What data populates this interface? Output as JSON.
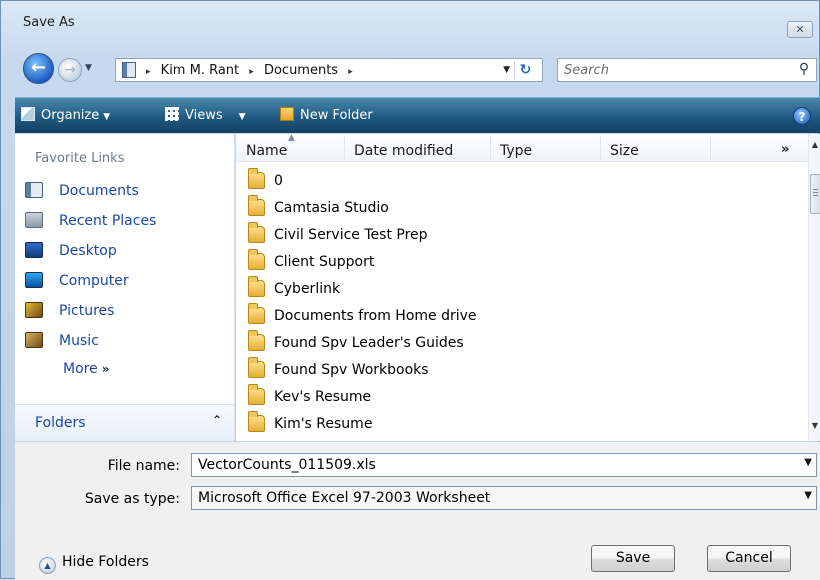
{
  "window": {
    "title": "Save As",
    "close_glyph": "✕"
  },
  "address": {
    "crumbs": [
      "Kim M. Rant",
      "Documents"
    ],
    "separator": "▸"
  },
  "search": {
    "placeholder": "Search"
  },
  "toolbar": {
    "organize_label": "Organize",
    "views_label": "Views",
    "new_folder_label": "New Folder",
    "help_glyph": "?"
  },
  "nav": {
    "favorites_heading": "Favorite Links",
    "links": [
      {
        "label": "Documents",
        "icon": "documents-icon"
      },
      {
        "label": "Recent Places",
        "icon": "recent-places-icon"
      },
      {
        "label": "Desktop",
        "icon": "desktop-icon"
      },
      {
        "label": "Computer",
        "icon": "computer-icon"
      },
      {
        "label": "Pictures",
        "icon": "pictures-icon"
      },
      {
        "label": "Music",
        "icon": "music-icon"
      }
    ],
    "more_label": "More",
    "folders_label": "Folders"
  },
  "file_list": {
    "columns": [
      "Name",
      "Date modified",
      "Type",
      "Size"
    ],
    "more_columns_glyph": "»",
    "items": [
      "0",
      "Camtasia Studio",
      "Civil Service Test Prep",
      "Client Support",
      "Cyberlink",
      "Documents from Home drive",
      "Found Spv Leader's Guides",
      "Found Spv Workbooks",
      "Kev's Resume",
      "Kim's Resume"
    ]
  },
  "form": {
    "file_name_label": "File name:",
    "file_name_value": "VectorCounts_011509.xls",
    "save_type_label": "Save as type:",
    "save_type_value": "Microsoft Office Excel 97-2003 Worksheet",
    "hide_folders_label": "Hide Folders",
    "save_button": "Save",
    "cancel_button": "Cancel"
  }
}
